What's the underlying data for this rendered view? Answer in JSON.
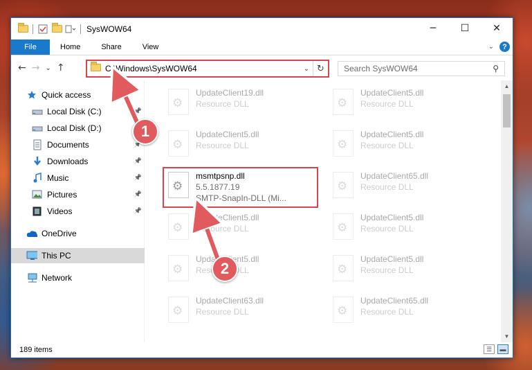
{
  "window": {
    "title": "SysWOW64"
  },
  "ribbon": {
    "tabs": [
      "File",
      "Home",
      "Share",
      "View"
    ],
    "help_label": "?"
  },
  "toolbar": {
    "back": "←",
    "forward": "→",
    "recent": "⌄",
    "up": "↑"
  },
  "address": {
    "path": "C:\\Windows\\SysWOW64"
  },
  "search": {
    "placeholder": "Search SysWOW64"
  },
  "sidebar": {
    "items": [
      {
        "label": "Quick access",
        "icon": "star-icon"
      },
      {
        "label": "Local Disk (C:)",
        "icon": "drive-icon",
        "pinned": true
      },
      {
        "label": "Local Disk (D:)",
        "icon": "drive-icon"
      },
      {
        "label": "Documents",
        "icon": "documents-icon",
        "pinned": true
      },
      {
        "label": "Downloads",
        "icon": "downloads-icon",
        "pinned": true
      },
      {
        "label": "Music",
        "icon": "music-icon",
        "pinned": true
      },
      {
        "label": "Pictures",
        "icon": "pictures-icon",
        "pinned": true
      },
      {
        "label": "Videos",
        "icon": "videos-icon",
        "pinned": true
      },
      {
        "label": "OneDrive",
        "icon": "onedrive-icon"
      },
      {
        "label": "This PC",
        "icon": "pc-icon",
        "selected": true
      },
      {
        "label": "Network",
        "icon": "network-icon"
      }
    ]
  },
  "files": [
    {
      "name": "UpdateClient19.dll",
      "desc": "Resource DLL"
    },
    {
      "name": "UpdateClient5.dll",
      "desc": "Resource DLL"
    },
    {
      "name": "UpdateClient5.dll",
      "desc": "Resource DLL"
    },
    {
      "name": "UpdateClient5.dll",
      "desc": "Resource DLL"
    },
    {
      "name": "msmtpsnp.dll",
      "version": "5.5.1877.19",
      "desc": "SMTP-SnapIn-DLL (Mi..."
    },
    {
      "name": "UpdateClient65.dll",
      "desc": "Resource DLL"
    },
    {
      "name": "UpdateClient5.dll",
      "desc": "Resource DLL"
    },
    {
      "name": "UpdateClient5.dll",
      "desc": "Resource DLL"
    },
    {
      "name": "UpdateClient5.dll",
      "desc": "Resource DLL"
    },
    {
      "name": "UpdateClient5.dll",
      "desc": "Resource DLL"
    },
    {
      "name": "UpdateClient63.dll",
      "desc": "Resource DLL"
    },
    {
      "name": "UpdateClient65.dll",
      "desc": "Resource DLL"
    }
  ],
  "status": {
    "count": "189 items"
  },
  "annotations": {
    "step1": "1",
    "step2": "2",
    "color": "#e05a5e"
  }
}
